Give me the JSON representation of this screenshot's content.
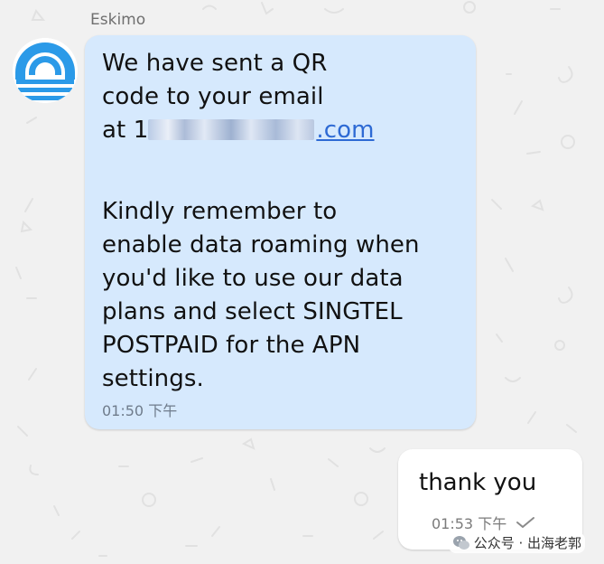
{
  "chat": {
    "incoming": {
      "sender_name": "Eskimo",
      "lines": [
        "We have sent a QR",
        "code to your email",
        "at 1",
        ".com",
        "Kindly remember to",
        "enable data roaming when",
        "you'd like to use our data",
        "plans and select SINGTEL",
        "POSTPAID for the APN",
        "settings."
      ],
      "time": "01:50 下午"
    },
    "outgoing": {
      "text": "thank you",
      "time": "01:53 下午",
      "status_icon": "check-icon"
    },
    "watermark": {
      "text": "公众号 · 出海老郭",
      "icon": "wechat-icon"
    }
  },
  "colors": {
    "background": "#f1f1f1",
    "incoming_bubble": "#d6e9fd",
    "outgoing_bubble": "#ffffff",
    "link": "#2e6ad4",
    "avatar": "#2b9ae8"
  }
}
